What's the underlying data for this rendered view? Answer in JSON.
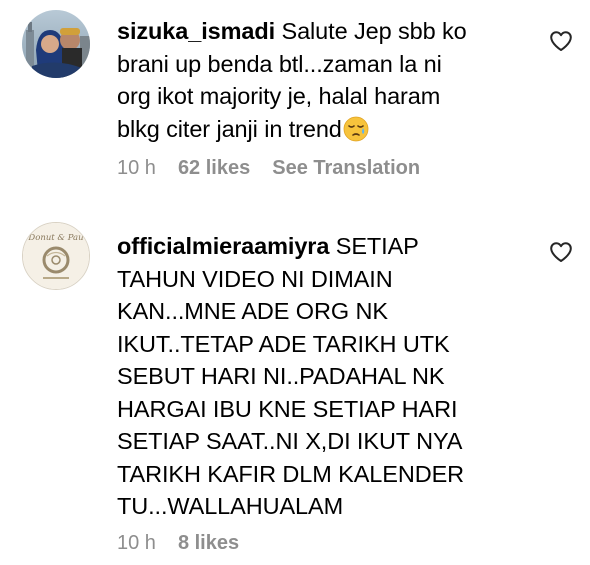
{
  "comments": [
    {
      "username": "sizuka_ismadi",
      "text_lines": [
        "Salute Jep sbb ko",
        "brani up benda btl...zaman la ni",
        "org ikot majority je, halal haram",
        "blkg citer janji in trend"
      ],
      "emoji": "sleepy-face-emoji",
      "time": "10 h",
      "likes": "62 likes",
      "translate": "See Translation",
      "avatar": "profile-photo-avatar"
    },
    {
      "username": "officialmieraamiyra",
      "text_lines": [
        "SETIAP",
        "TAHUN VIDEO NI DIMAIN",
        "KAN...MNE ADE ORG NK",
        "IKUT..TETAP ADE TARIKH UTK",
        "SEBUT HARI NI..PADAHAL NK",
        "HARGAI IBU KNE SETIAP HARI",
        "SETIAP SAAT..NI X,DI IKUT NYA",
        "TARIKH KAFIR DLM KALENDER",
        "TU...WALLAHUALAM"
      ],
      "time": "10 h",
      "likes": "8 likes",
      "avatar": "donut-shop-logo-avatar",
      "avatar_logo_text": "Donut & Pau"
    }
  ],
  "colors": {
    "text": "#000000",
    "muted": "#8e8e8e"
  },
  "icons": {
    "like": "heart-outline-icon"
  }
}
